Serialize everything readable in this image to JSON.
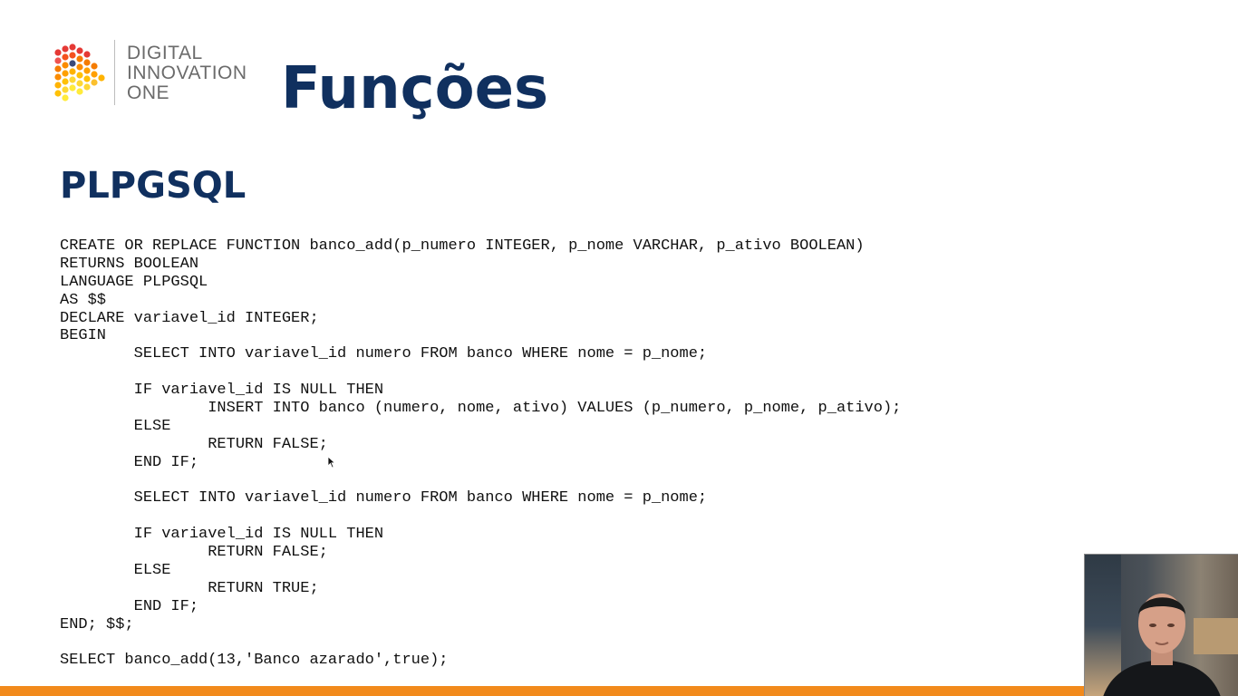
{
  "logo": {
    "line1": "DIGITAL",
    "line2": "INNOVATION",
    "line3": "ONE",
    "colors": [
      "#e53935",
      "#f57c00",
      "#fbc02d"
    ]
  },
  "slide": {
    "title": "Funções",
    "subtitle": "PLPGSQL",
    "title_color": "#10305f",
    "accent_bar_color": "#f28a1c"
  },
  "code": {
    "lines": [
      "CREATE OR REPLACE FUNCTION banco_add(p_numero INTEGER, p_nome VARCHAR, p_ativo BOOLEAN)",
      "RETURNS BOOLEAN",
      "LANGUAGE PLPGSQL",
      "AS $$",
      "DECLARE variavel_id INTEGER;",
      "BEGIN",
      "        SELECT INTO variavel_id numero FROM banco WHERE nome = p_nome;",
      "",
      "        IF variavel_id IS NULL THEN",
      "                INSERT INTO banco (numero, nome, ativo) VALUES (p_numero, p_nome, p_ativo);",
      "        ELSE",
      "                RETURN FALSE;",
      "        END IF;",
      "",
      "        SELECT INTO variavel_id numero FROM banco WHERE nome = p_nome;",
      "",
      "        IF variavel_id IS NULL THEN",
      "                RETURN FALSE;",
      "        ELSE",
      "                RETURN TRUE;",
      "        END IF;",
      "END; $$;",
      "",
      "SELECT banco_add(13,'Banco azarado',true);"
    ]
  },
  "overlay": {
    "webcam_icon": "presenter-webcam-icon"
  }
}
